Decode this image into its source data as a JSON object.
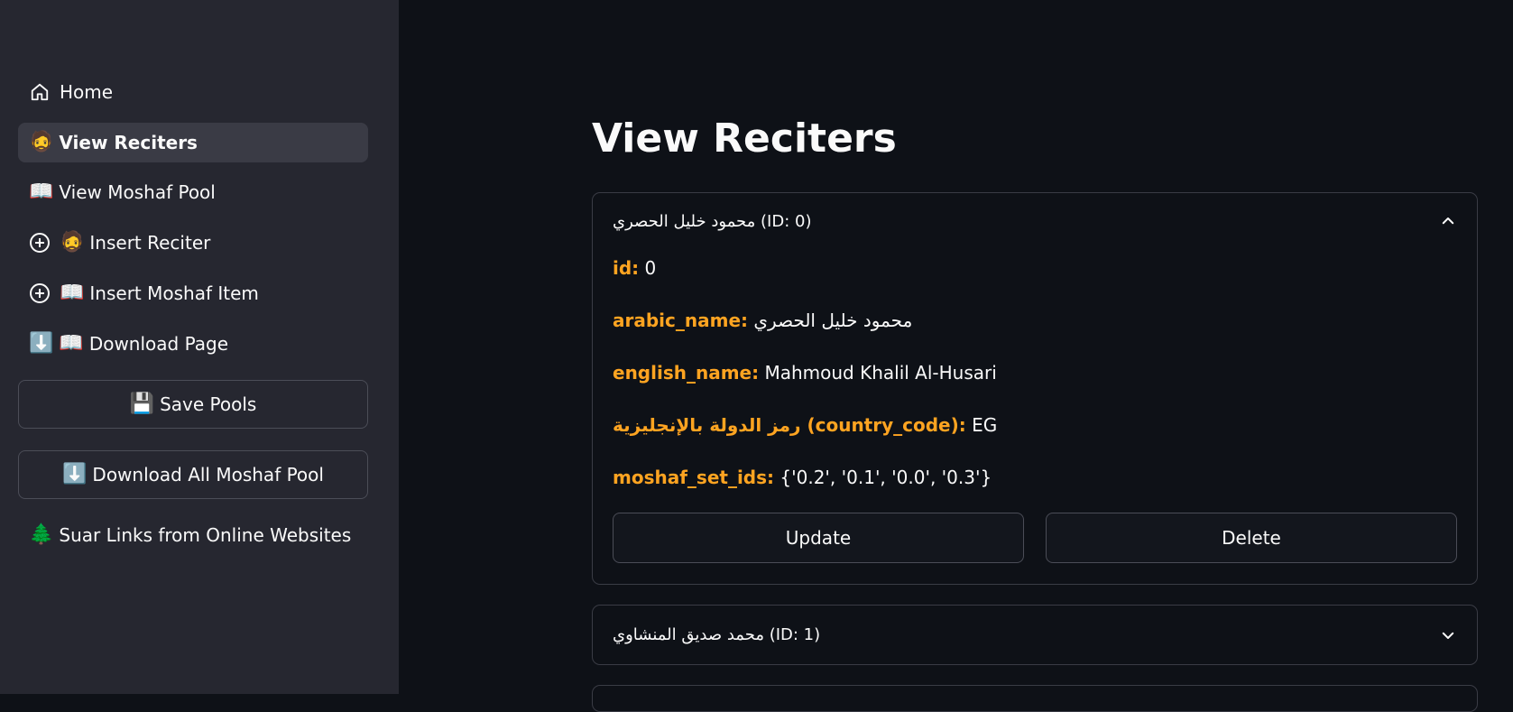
{
  "sidebar": {
    "nav": [
      {
        "icon": "home-icon",
        "emoji": "",
        "label": "Home"
      },
      {
        "icon": "",
        "emoji": "🧔",
        "label": "View Reciters"
      },
      {
        "icon": "",
        "emoji": "📖",
        "label": "View Moshaf Pool"
      },
      {
        "icon": "plus-circle-icon",
        "emoji": "🧔",
        "label": "Insert Reciter"
      },
      {
        "icon": "plus-circle-icon",
        "emoji": "📖",
        "label": "Insert Moshaf Item"
      },
      {
        "icon": "",
        "emoji": "⬇️",
        "emoji2": "📖",
        "label": "Download Page"
      }
    ],
    "save_pools": {
      "emoji": "💾",
      "label": "Save Pools"
    },
    "download_all": {
      "emoji": "⬇️",
      "label": "Download All Moshaf Pool"
    },
    "suar_links": {
      "emoji": "🌲",
      "label": "Suar Links from Online Websites"
    }
  },
  "main": {
    "title": "View Reciters",
    "expanders": [
      {
        "header": "محمود خليل الحصري (ID: 0)",
        "fields": [
          {
            "key": "id:",
            "value": "0"
          },
          {
            "key": "arabic_name:",
            "value": "محمود خليل الحصري"
          },
          {
            "key": "english_name:",
            "value": "Mahmoud Khalil Al-Husari"
          },
          {
            "key": "رمز الدولة بالإنجليزية (country_code):",
            "value": "EG"
          },
          {
            "key": "moshaf_set_ids:",
            "value": "{'0.2', '0.1', '0.0', '0.3'}"
          }
        ],
        "update_label": "Update",
        "delete_label": "Delete"
      },
      {
        "header": "محمد صديق المنشاوي (ID: 1)"
      }
    ]
  }
}
